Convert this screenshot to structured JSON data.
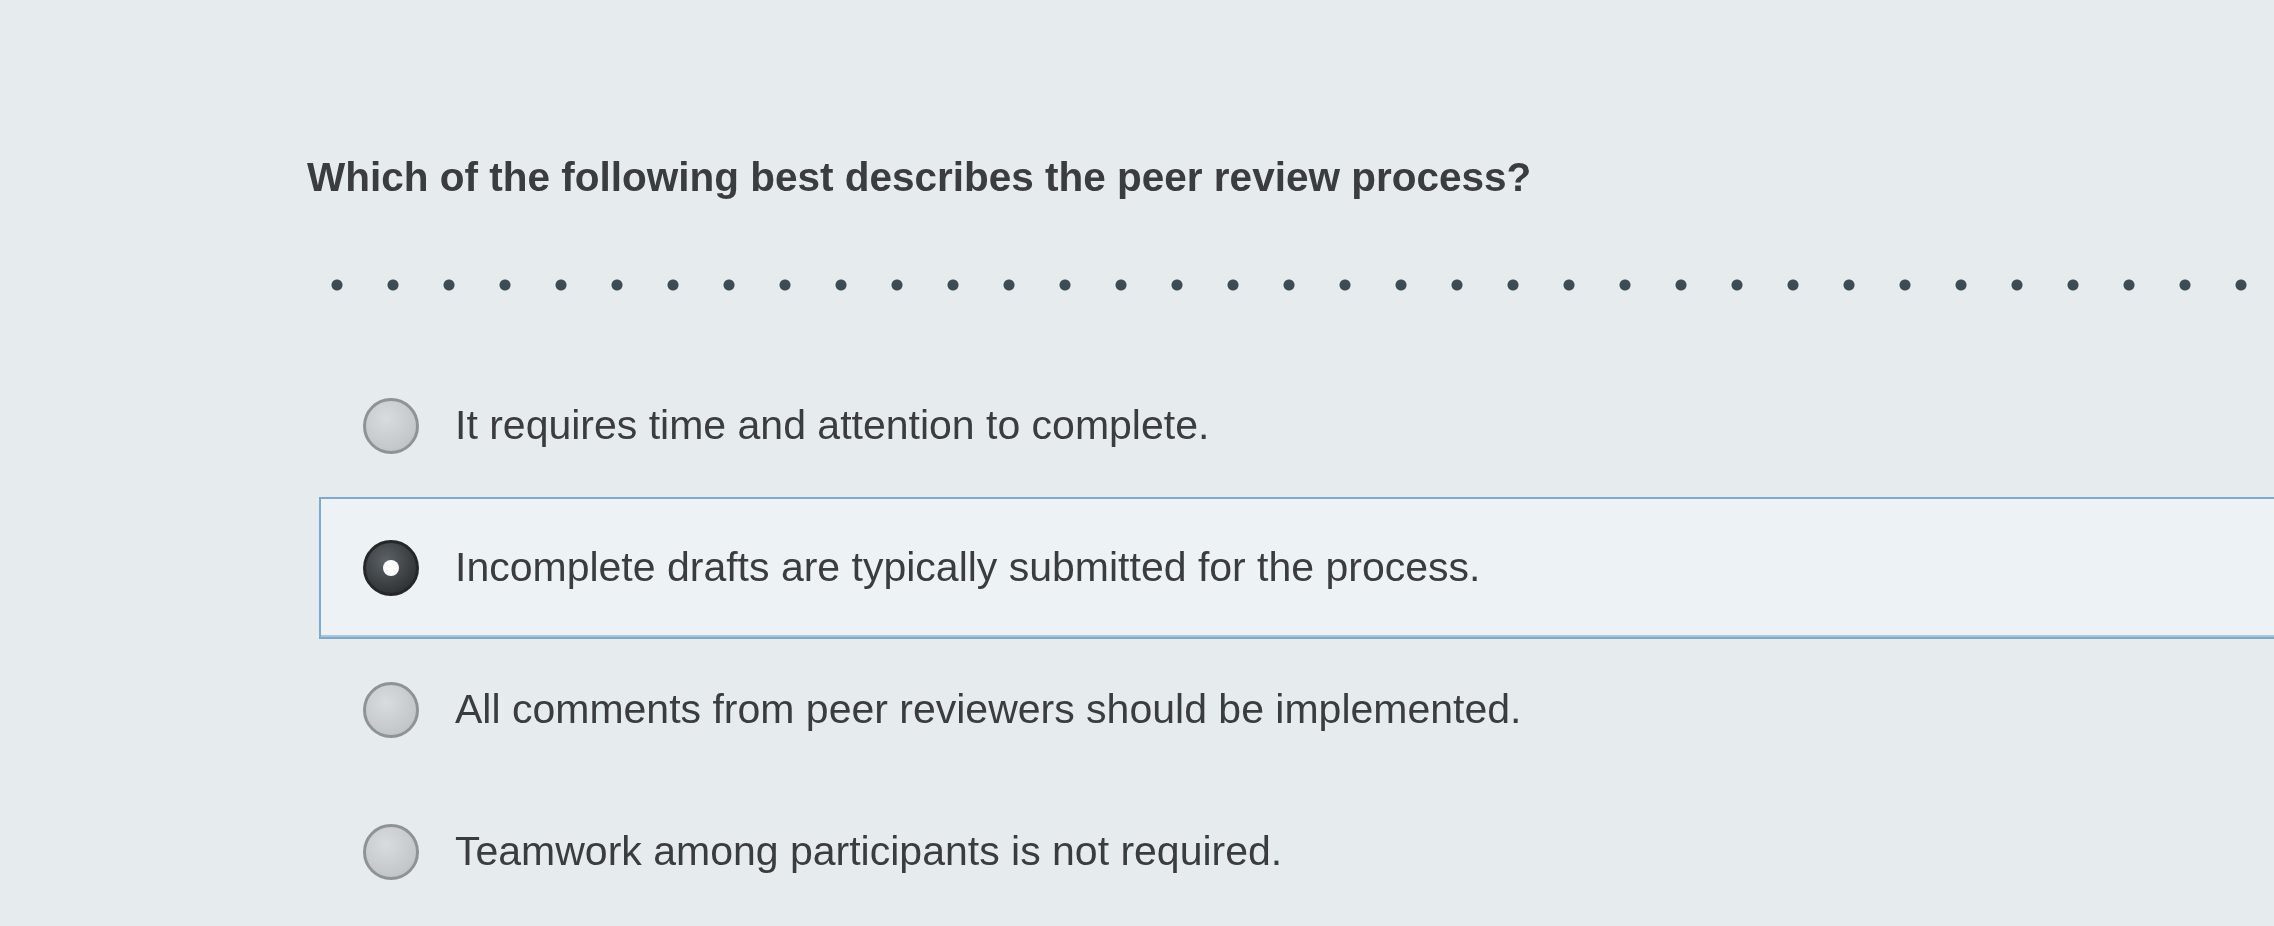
{
  "question": {
    "text": "Which of the following best describes the peer review process?"
  },
  "options": [
    {
      "label": "It requires time and attention to complete.",
      "selected": false
    },
    {
      "label": "Incomplete drafts are typically submitted for the process.",
      "selected": true
    },
    {
      "label": "All comments from peer reviewers should be implemented.",
      "selected": false
    },
    {
      "label": "Teamwork among participants is not required.",
      "selected": false
    }
  ]
}
